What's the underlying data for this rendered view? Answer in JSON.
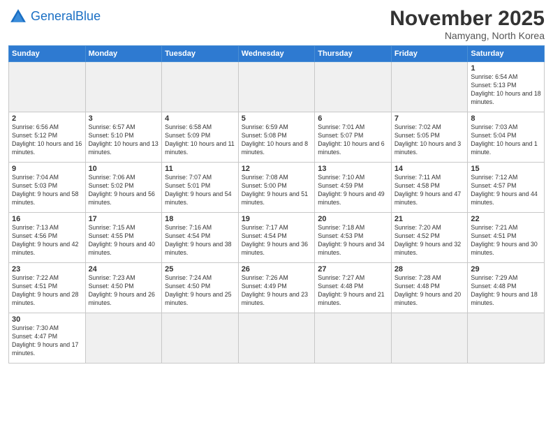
{
  "header": {
    "logo_general": "General",
    "logo_blue": "Blue",
    "month_year": "November 2025",
    "location": "Namyang, North Korea"
  },
  "weekdays": [
    "Sunday",
    "Monday",
    "Tuesday",
    "Wednesday",
    "Thursday",
    "Friday",
    "Saturday"
  ],
  "weeks": [
    [
      {
        "day": "",
        "empty": true
      },
      {
        "day": "",
        "empty": true
      },
      {
        "day": "",
        "empty": true
      },
      {
        "day": "",
        "empty": true
      },
      {
        "day": "",
        "empty": true
      },
      {
        "day": "",
        "empty": true
      },
      {
        "day": "1",
        "sunrise": "6:54 AM",
        "sunset": "5:13 PM",
        "daylight": "10 hours and 18 minutes."
      }
    ],
    [
      {
        "day": "2",
        "sunrise": "6:56 AM",
        "sunset": "5:12 PM",
        "daylight": "10 hours and 16 minutes."
      },
      {
        "day": "3",
        "sunrise": "6:57 AM",
        "sunset": "5:10 PM",
        "daylight": "10 hours and 13 minutes."
      },
      {
        "day": "4",
        "sunrise": "6:58 AM",
        "sunset": "5:09 PM",
        "daylight": "10 hours and 11 minutes."
      },
      {
        "day": "5",
        "sunrise": "6:59 AM",
        "sunset": "5:08 PM",
        "daylight": "10 hours and 8 minutes."
      },
      {
        "day": "6",
        "sunrise": "7:01 AM",
        "sunset": "5:07 PM",
        "daylight": "10 hours and 6 minutes."
      },
      {
        "day": "7",
        "sunrise": "7:02 AM",
        "sunset": "5:05 PM",
        "daylight": "10 hours and 3 minutes."
      },
      {
        "day": "8",
        "sunrise": "7:03 AM",
        "sunset": "5:04 PM",
        "daylight": "10 hours and 1 minute."
      }
    ],
    [
      {
        "day": "9",
        "sunrise": "7:04 AM",
        "sunset": "5:03 PM",
        "daylight": "9 hours and 58 minutes."
      },
      {
        "day": "10",
        "sunrise": "7:06 AM",
        "sunset": "5:02 PM",
        "daylight": "9 hours and 56 minutes."
      },
      {
        "day": "11",
        "sunrise": "7:07 AM",
        "sunset": "5:01 PM",
        "daylight": "9 hours and 54 minutes."
      },
      {
        "day": "12",
        "sunrise": "7:08 AM",
        "sunset": "5:00 PM",
        "daylight": "9 hours and 51 minutes."
      },
      {
        "day": "13",
        "sunrise": "7:10 AM",
        "sunset": "4:59 PM",
        "daylight": "9 hours and 49 minutes."
      },
      {
        "day": "14",
        "sunrise": "7:11 AM",
        "sunset": "4:58 PM",
        "daylight": "9 hours and 47 minutes."
      },
      {
        "day": "15",
        "sunrise": "7:12 AM",
        "sunset": "4:57 PM",
        "daylight": "9 hours and 44 minutes."
      }
    ],
    [
      {
        "day": "16",
        "sunrise": "7:13 AM",
        "sunset": "4:56 PM",
        "daylight": "9 hours and 42 minutes."
      },
      {
        "day": "17",
        "sunrise": "7:15 AM",
        "sunset": "4:55 PM",
        "daylight": "9 hours and 40 minutes."
      },
      {
        "day": "18",
        "sunrise": "7:16 AM",
        "sunset": "4:54 PM",
        "daylight": "9 hours and 38 minutes."
      },
      {
        "day": "19",
        "sunrise": "7:17 AM",
        "sunset": "4:54 PM",
        "daylight": "9 hours and 36 minutes."
      },
      {
        "day": "20",
        "sunrise": "7:18 AM",
        "sunset": "4:53 PM",
        "daylight": "9 hours and 34 minutes."
      },
      {
        "day": "21",
        "sunrise": "7:20 AM",
        "sunset": "4:52 PM",
        "daylight": "9 hours and 32 minutes."
      },
      {
        "day": "22",
        "sunrise": "7:21 AM",
        "sunset": "4:51 PM",
        "daylight": "9 hours and 30 minutes."
      }
    ],
    [
      {
        "day": "23",
        "sunrise": "7:22 AM",
        "sunset": "4:51 PM",
        "daylight": "9 hours and 28 minutes."
      },
      {
        "day": "24",
        "sunrise": "7:23 AM",
        "sunset": "4:50 PM",
        "daylight": "9 hours and 26 minutes."
      },
      {
        "day": "25",
        "sunrise": "7:24 AM",
        "sunset": "4:50 PM",
        "daylight": "9 hours and 25 minutes."
      },
      {
        "day": "26",
        "sunrise": "7:26 AM",
        "sunset": "4:49 PM",
        "daylight": "9 hours and 23 minutes."
      },
      {
        "day": "27",
        "sunrise": "7:27 AM",
        "sunset": "4:48 PM",
        "daylight": "9 hours and 21 minutes."
      },
      {
        "day": "28",
        "sunrise": "7:28 AM",
        "sunset": "4:48 PM",
        "daylight": "9 hours and 20 minutes."
      },
      {
        "day": "29",
        "sunrise": "7:29 AM",
        "sunset": "4:48 PM",
        "daylight": "9 hours and 18 minutes."
      }
    ],
    [
      {
        "day": "30",
        "sunrise": "7:30 AM",
        "sunset": "4:47 PM",
        "daylight": "9 hours and 17 minutes."
      },
      {
        "day": "",
        "empty": true
      },
      {
        "day": "",
        "empty": true
      },
      {
        "day": "",
        "empty": true
      },
      {
        "day": "",
        "empty": true
      },
      {
        "day": "",
        "empty": true
      },
      {
        "day": "",
        "empty": true
      }
    ]
  ]
}
